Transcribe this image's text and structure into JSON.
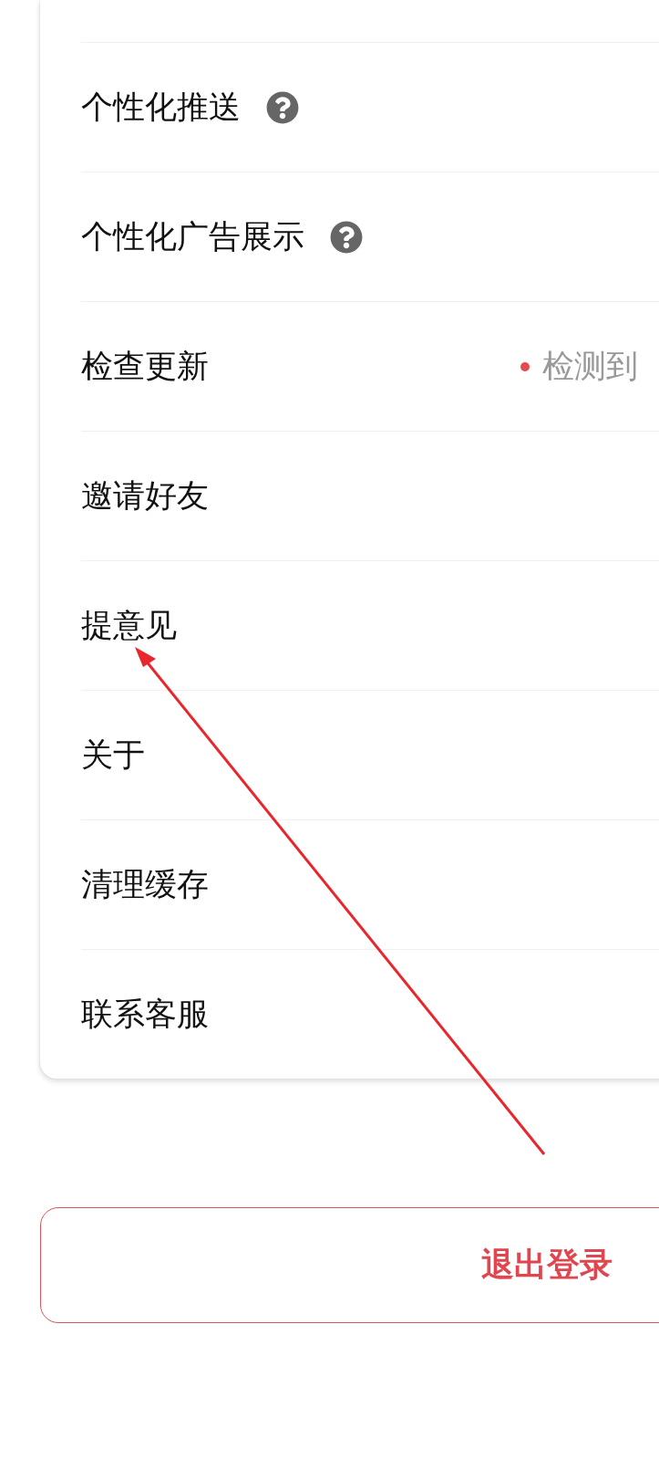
{
  "settings": {
    "items": [
      {
        "label": "个性化推送",
        "help": true
      },
      {
        "label": "个性化广告展示",
        "help": true
      },
      {
        "label": "检查更新",
        "help": false,
        "status": "检测到",
        "status_dot": true
      },
      {
        "label": "邀请好友",
        "help": false
      },
      {
        "label": "提意见",
        "help": false
      },
      {
        "label": "关于",
        "help": false
      },
      {
        "label": "清理缓存",
        "help": false
      },
      {
        "label": "联系客服",
        "help": false
      }
    ]
  },
  "logout_button": "退出登录"
}
